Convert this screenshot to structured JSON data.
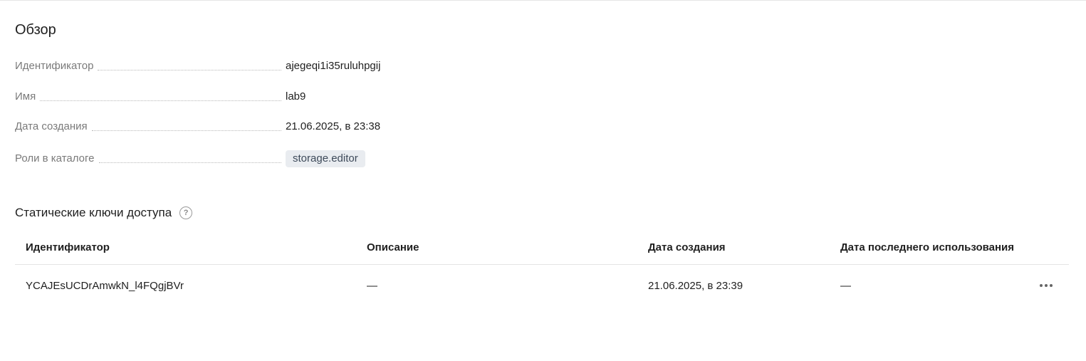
{
  "overview": {
    "title": "Обзор",
    "fields": [
      {
        "label": "Идентификатор",
        "value": "ajegeqi1i35ruluhpgij"
      },
      {
        "label": "Имя",
        "value": "lab9"
      },
      {
        "label": "Дата создания",
        "value": "21.06.2025, в 23:38"
      },
      {
        "label": "Роли в каталоге",
        "value": "storage.editor"
      }
    ]
  },
  "static_keys": {
    "title": "Статические ключи доступа",
    "help_icon": "question-circle-icon",
    "columns": [
      "Идентификатор",
      "Описание",
      "Дата создания",
      "Дата последнего использования"
    ],
    "rows": [
      {
        "id": "YCAJEsUCDrAmwkN_l4FQgjBVr",
        "description": "—",
        "created": "21.06.2025, в 23:39",
        "last_used": "—",
        "actions_icon": "more-horizontal-icon"
      }
    ]
  }
}
